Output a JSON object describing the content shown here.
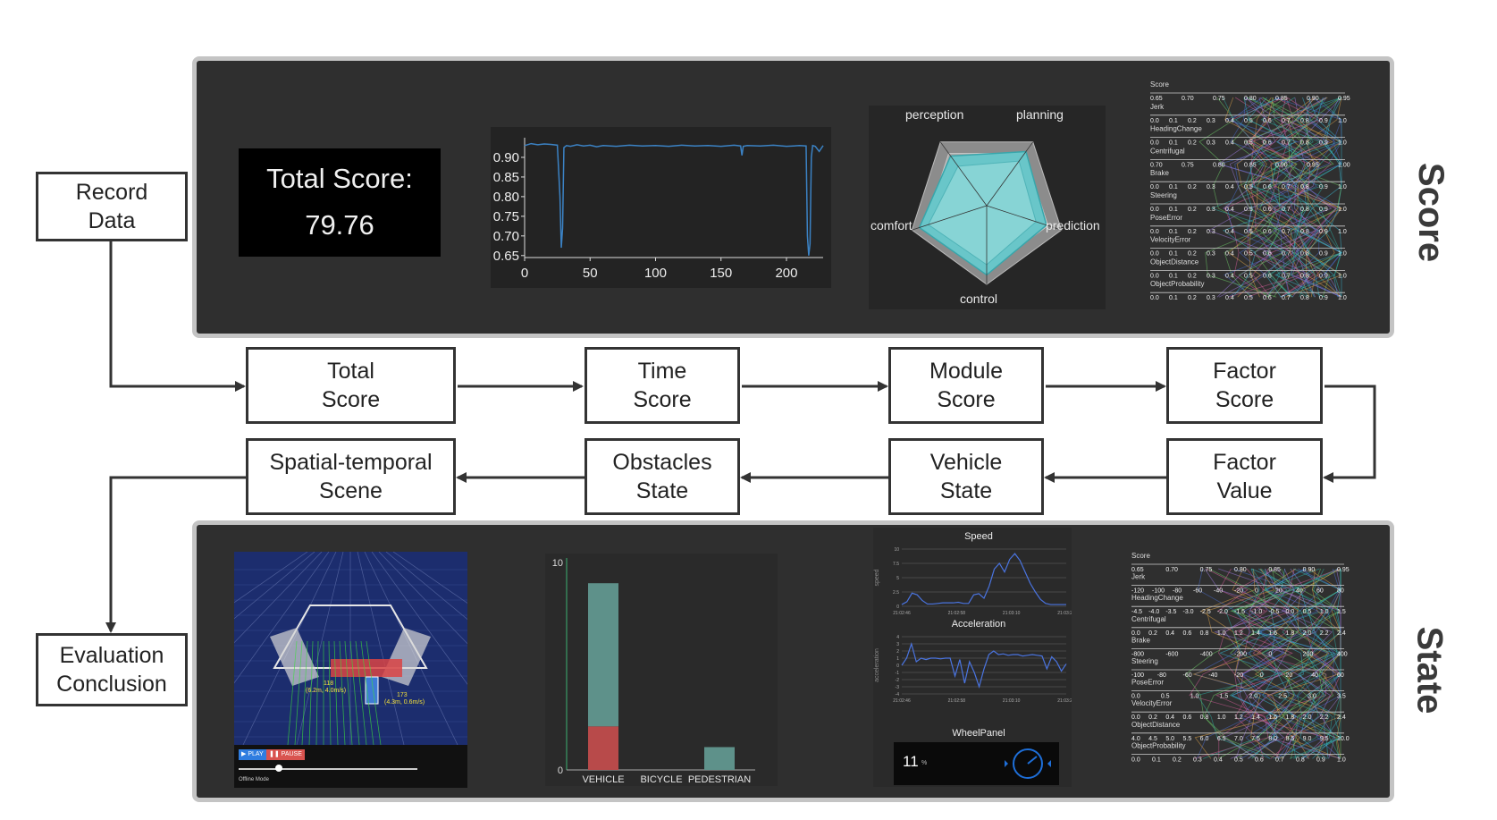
{
  "panels": {
    "score_label": "Score",
    "state_label": "State"
  },
  "flow": {
    "record_data": "Record\nData",
    "total_score": "Total\nScore",
    "time_score": "Time\nScore",
    "module_score": "Module\nScore",
    "factor_score": "Factor\nScore",
    "factor_value": "Factor\nValue",
    "vehicle_state": "Vehicle\nState",
    "obstacles_state": "Obstacles\nState",
    "spatial_temporal": "Spatial-temporal\nScene",
    "evaluation_conclusion": "Evaluation\nConclusion"
  },
  "total_score_widget": {
    "title": "Total Score:",
    "value": "79.76"
  },
  "radar": {
    "axes": [
      "perception",
      "planning",
      "prediction",
      "control",
      "comfort"
    ]
  },
  "score_parcoords": {
    "rows": [
      {
        "name": "Score",
        "ticks": [
          "0.65",
          "0.70",
          "0.75",
          "0.80",
          "0.85",
          "0.90",
          "0.95"
        ]
      },
      {
        "name": "Jerk",
        "ticks": [
          "0.0",
          "0.1",
          "0.2",
          "0.3",
          "0.4",
          "0.5",
          "0.6",
          "0.7",
          "0.8",
          "0.9",
          "1.0"
        ]
      },
      {
        "name": "HeadingChange",
        "ticks": [
          "0.0",
          "0.1",
          "0.2",
          "0.3",
          "0.4",
          "0.5",
          "0.6",
          "0.7",
          "0.8",
          "0.9",
          "1.0"
        ]
      },
      {
        "name": "Centrifugal",
        "ticks": [
          "0.70",
          "0.75",
          "0.80",
          "0.85",
          "0.90",
          "0.95",
          "1.00"
        ]
      },
      {
        "name": "Brake",
        "ticks": [
          "0.0",
          "0.1",
          "0.2",
          "0.3",
          "0.4",
          "0.5",
          "0.6",
          "0.7",
          "0.8",
          "0.9",
          "1.0"
        ]
      },
      {
        "name": "Steering",
        "ticks": [
          "0.0",
          "0.1",
          "0.2",
          "0.3",
          "0.4",
          "0.5",
          "0.6",
          "0.7",
          "0.8",
          "0.9",
          "1.0"
        ]
      },
      {
        "name": "PoseError",
        "ticks": [
          "0.0",
          "0.1",
          "0.2",
          "0.3",
          "0.4",
          "0.5",
          "0.6",
          "0.7",
          "0.8",
          "0.9",
          "1.0"
        ]
      },
      {
        "name": "VelocityError",
        "ticks": [
          "0.0",
          "0.1",
          "0.2",
          "0.3",
          "0.4",
          "0.5",
          "0.6",
          "0.7",
          "0.8",
          "0.9",
          "1.0"
        ]
      },
      {
        "name": "ObjectDistance",
        "ticks": [
          "0.0",
          "0.1",
          "0.2",
          "0.3",
          "0.4",
          "0.5",
          "0.6",
          "0.7",
          "0.8",
          "0.9",
          "1.0"
        ]
      },
      {
        "name": "ObjectProbability",
        "ticks": [
          "0.0",
          "0.1",
          "0.2",
          "0.3",
          "0.4",
          "0.5",
          "0.6",
          "0.7",
          "0.8",
          "0.9",
          "1.0"
        ]
      }
    ]
  },
  "state_parcoords": {
    "rows": [
      {
        "name": "Score",
        "ticks": [
          "0.65",
          "0.70",
          "0.75",
          "0.80",
          "0.85",
          "0.90",
          "0.95"
        ]
      },
      {
        "name": "Jerk",
        "ticks": [
          "-120",
          "-100",
          "-80",
          "-60",
          "-40",
          "-20",
          "0",
          "20",
          "40",
          "60",
          "80"
        ]
      },
      {
        "name": "HeadingChange",
        "ticks": [
          "-4.5",
          "-4.0",
          "-3.5",
          "-3.0",
          "-2.5",
          "-2.0",
          "-1.5",
          "-1.0",
          "-0.5",
          "0.0",
          "0.5",
          "1.0",
          "1.5"
        ]
      },
      {
        "name": "Centrifugal",
        "ticks": [
          "0.0",
          "0.2",
          "0.4",
          "0.6",
          "0.8",
          "1.0",
          "1.2",
          "1.4",
          "1.6",
          "1.8",
          "2.0",
          "2.2",
          "2.4"
        ]
      },
      {
        "name": "Brake",
        "ticks": [
          "-800",
          "-600",
          "-400",
          "-200",
          "0",
          "200",
          "400"
        ]
      },
      {
        "name": "Steering",
        "ticks": [
          "-100",
          "-80",
          "-60",
          "-40",
          "-20",
          "0",
          "20",
          "40",
          "60"
        ]
      },
      {
        "name": "PoseError",
        "ticks": [
          "0.0",
          "0.5",
          "1.0",
          "1.5",
          "2.0",
          "2.5",
          "3.0",
          "3.5"
        ]
      },
      {
        "name": "VelocityError",
        "ticks": [
          "0.0",
          "0.2",
          "0.4",
          "0.6",
          "0.8",
          "1.0",
          "1.2",
          "1.4",
          "1.6",
          "1.8",
          "2.0",
          "2.2",
          "2.4"
        ]
      },
      {
        "name": "ObjectDistance",
        "ticks": [
          "4.0",
          "4.5",
          "5.0",
          "5.5",
          "6.0",
          "6.5",
          "7.0",
          "7.5",
          "8.0",
          "8.5",
          "9.0",
          "9.5",
          "10.0"
        ]
      },
      {
        "name": "ObjectProbability",
        "ticks": [
          "0.0",
          "0.1",
          "0.2",
          "0.3",
          "0.4",
          "0.5",
          "0.6",
          "0.7",
          "0.8",
          "0.9",
          "1.0"
        ]
      }
    ]
  },
  "scene": {
    "play_label": "▶ PLAY",
    "pause_label": "❚❚ PAUSE",
    "offline_label": "Offline Mode",
    "annotation_1": "118",
    "annotation_1b": "(6.2m, 4.0m/s)",
    "annotation_2": "173",
    "annotation_2b": "(4.3m, 0.6m/s)"
  },
  "vehicle_state": {
    "speed_title": "Speed",
    "speed_ylabel": "speed",
    "accel_title": "Acceleration",
    "accel_ylabel": "acceleration",
    "speed_ticks": [
      "10",
      "7.5",
      "5",
      "2.5",
      "0"
    ],
    "accel_ticks": [
      "4",
      "3",
      "2",
      "1",
      "0",
      "-1",
      "-2",
      "-3",
      "-4"
    ],
    "time_ticks": [
      "21:02:46",
      "21:02:58",
      "21:03:10",
      "21:03:22"
    ],
    "wheel_title": "WheelPanel",
    "wheel_value": "11",
    "wheel_unit": "%"
  },
  "chart_data": [
    {
      "type": "line",
      "title": "",
      "xlabel": "",
      "ylabel": "",
      "x_ticks": [
        0,
        50,
        100,
        150,
        200
      ],
      "y_ticks": [
        0.65,
        0.7,
        0.75,
        0.8,
        0.85,
        0.9
      ],
      "xlim": [
        0,
        228
      ],
      "ylim": [
        0.645,
        0.95
      ],
      "series": [
        {
          "x": [
            0,
            5,
            10,
            15,
            20,
            25,
            27,
            28,
            29,
            30,
            32,
            35,
            40,
            45,
            50,
            55,
            60,
            70,
            80,
            90,
            100,
            110,
            120,
            130,
            140,
            150,
            160,
            165,
            166,
            167,
            170,
            180,
            190,
            200,
            210,
            215,
            216,
            217,
            218,
            219,
            220,
            222,
            225,
            228
          ],
          "y": [
            0.93,
            0.935,
            0.932,
            0.934,
            0.933,
            0.931,
            0.8,
            0.67,
            0.72,
            0.925,
            0.93,
            0.928,
            0.932,
            0.929,
            0.931,
            0.927,
            0.93,
            0.928,
            0.931,
            0.929,
            0.93,
            0.928,
            0.931,
            0.929,
            0.93,
            0.928,
            0.931,
            0.929,
            0.905,
            0.928,
            0.93,
            0.929,
            0.931,
            0.928,
            0.93,
            0.929,
            0.7,
            0.65,
            0.68,
            0.9,
            0.93,
            0.928,
            0.915,
            0.93
          ]
        }
      ]
    },
    {
      "type": "bar",
      "title": "",
      "categories": [
        "VEHICLE",
        "BICYCLE",
        "PEDESTRIAN"
      ],
      "y_ticks": [
        0,
        10
      ],
      "ylim": [
        0,
        10
      ],
      "series": [
        {
          "values": [
            2.1,
            0,
            0
          ],
          "color": "#b84a4a"
        },
        {
          "values": [
            6.9,
            0,
            1.1
          ],
          "color": "#5e918a"
        }
      ]
    },
    {
      "type": "radar",
      "axes": [
        "perception",
        "planning",
        "prediction",
        "control",
        "comfort"
      ],
      "series": [
        {
          "values": [
            0.78,
            0.85,
            0.8,
            0.88,
            0.9
          ]
        },
        {
          "values": [
            0.62,
            0.7,
            0.66,
            0.75,
            0.78
          ]
        }
      ]
    },
    {
      "type": "line",
      "title": "Speed",
      "ylabel": "speed",
      "y_ticks": [
        0,
        2.5,
        5,
        7.5,
        10
      ],
      "ylim": [
        0,
        10
      ],
      "x_ticks": [
        "21:02:46",
        "21:02:58",
        "21:03:10",
        "21:03:22"
      ],
      "series": [
        {
          "values": [
            0.3,
            0.8,
            2.3,
            2.0,
            1.0,
            0.4,
            0.4,
            0.5,
            0.6,
            0.6,
            0.6,
            0.7,
            0.5,
            0.5,
            2.0,
            2.2,
            1.4,
            3.5,
            6.5,
            7.5,
            6.0,
            8.2,
            9.2,
            8.0,
            6.0,
            4.0,
            2.5,
            1.2,
            0.5,
            0.3,
            0.3,
            0.3,
            0.3
          ]
        }
      ]
    },
    {
      "type": "line",
      "title": "Acceleration",
      "ylabel": "acceleration",
      "y_ticks": [
        -4,
        -3,
        -2,
        -1,
        0,
        1,
        2,
        3,
        4
      ],
      "ylim": [
        -4,
        4
      ],
      "x_ticks": [
        "21:02:46",
        "21:02:58",
        "21:03:10",
        "21:03:22"
      ],
      "series": [
        {
          "values": [
            0.0,
            1.0,
            3.0,
            0.5,
            1.0,
            0.8,
            1.0,
            1.0,
            0.9,
            1.0,
            1.0,
            -1.5,
            0.8,
            -2.5,
            0.5,
            -1.0,
            -3.0,
            -0.5,
            1.5,
            2.0,
            1.5,
            1.6,
            1.4,
            1.5,
            1.5,
            1.3,
            1.4,
            1.5,
            1.4,
            1.3,
            -0.5,
            1.2,
            0.5,
            -0.8,
            0.2
          ]
        }
      ]
    }
  ]
}
